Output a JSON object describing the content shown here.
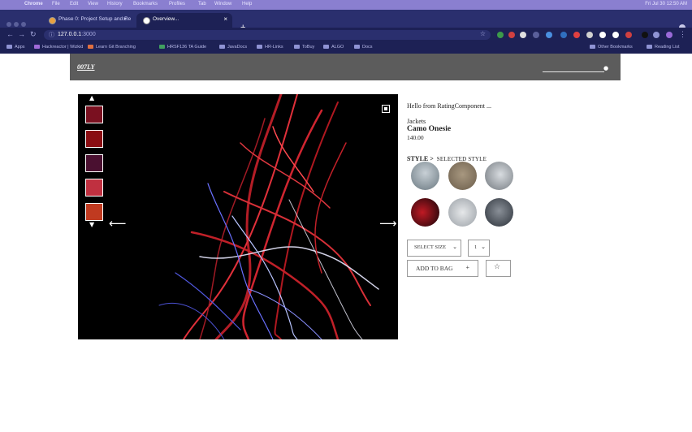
{
  "macos": {
    "app": "Chrome",
    "menus": [
      "File",
      "Edit",
      "View",
      "History",
      "Bookmarks",
      "Profiles",
      "Tab",
      "Window",
      "Help"
    ],
    "clock": "Fri Jul 30  12:50 AM"
  },
  "browser": {
    "tabs": [
      {
        "title": "Phase 0: Project Setup and Re",
        "active": false
      },
      {
        "title": "Overview...",
        "active": true
      }
    ],
    "new_tab": "+",
    "url_host": "127.0.0.1",
    "url_port": ":3000",
    "bookmarks": [
      "Apps",
      "Hackreactor | Wizkid",
      "Learn Git Branching",
      "HRSF136 TA Guide",
      "JavaDocs",
      "HR-Links",
      "ToBuy",
      "ALGO",
      "Docs",
      "Other Bookmarks",
      "Reading List"
    ]
  },
  "site": {
    "logo": "007LY",
    "search_placeholder": ""
  },
  "gallery": {
    "up_arrow": "▲",
    "down_arrow": "▼",
    "prev_arrow": "⟵",
    "next_arrow": "⟶",
    "thumbnail_colors": [
      "#7a1020",
      "#8a0d12",
      "#4a1030",
      "#c03040",
      "#c03a20"
    ]
  },
  "product": {
    "rating_text": "Hello from RatingComponent ...",
    "category": "Jackets",
    "name": "Camo Onesie",
    "price": "140.00",
    "style_label": "STYLE >",
    "selected_style": "SELECTED STYLE",
    "style_colors": [
      "#7c8a90",
      "#8a7a66",
      "#9aa0a6",
      "#8b1018",
      "#b8bcc0",
      "#4a5058"
    ]
  },
  "cart": {
    "size_label": "SELECT SIZE",
    "quantity": "1",
    "add_to_bag": "ADD TO BAG",
    "add_plus": "+",
    "favorite_icon": "☆"
  }
}
